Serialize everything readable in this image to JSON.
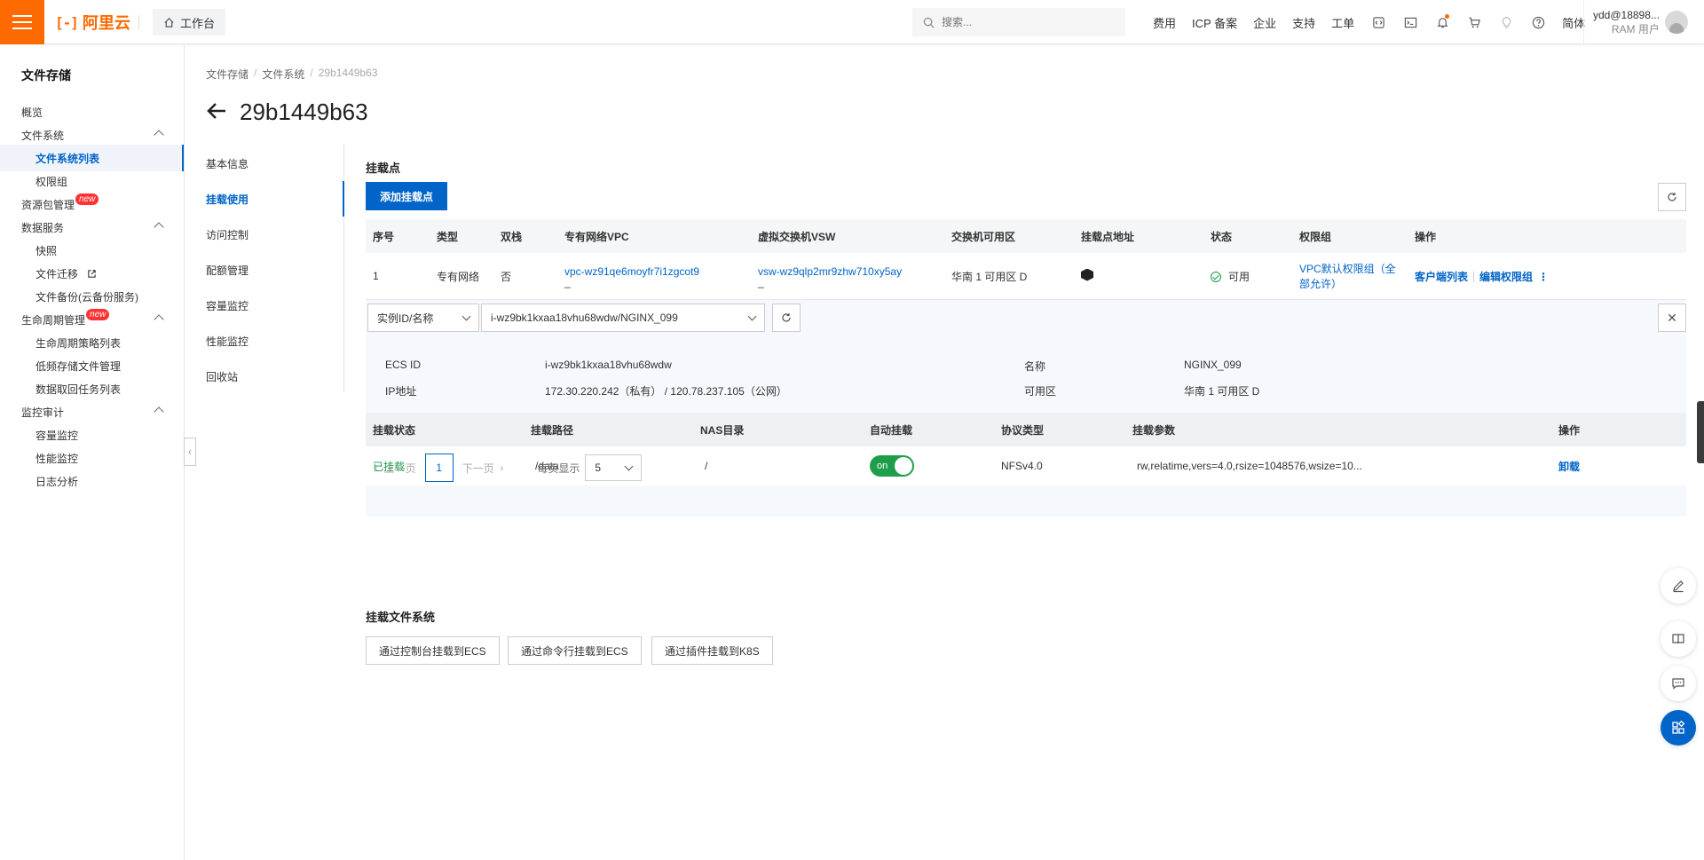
{
  "header": {
    "brand": "阿里云",
    "workbench": "工作台",
    "search_placeholder": "搜索...",
    "nav": [
      "费用",
      "ICP 备案",
      "企业",
      "支持",
      "工单"
    ],
    "lang": "简体",
    "user_name": "ydd@18898...",
    "user_role": "RAM 用户",
    "accent": "#ff6a00"
  },
  "sidebar": {
    "title": "文件存储",
    "items": [
      {
        "label": "概览"
      },
      {
        "label": "文件系统"
      },
      {
        "label": "文件系统列表"
      },
      {
        "label": "权限组"
      },
      {
        "label": "资源包管理"
      },
      {
        "label": "数据服务"
      },
      {
        "label": "快照"
      },
      {
        "label": "文件迁移"
      },
      {
        "label": "文件备份(云备份服务)"
      },
      {
        "label": "生命周期管理"
      },
      {
        "label": "生命周期策略列表"
      },
      {
        "label": "低频存储文件管理"
      },
      {
        "label": "数据取回任务列表"
      },
      {
        "label": "监控审计"
      },
      {
        "label": "容量监控"
      },
      {
        "label": "性能监控"
      },
      {
        "label": "日志分析"
      }
    ],
    "new_badge": "new"
  },
  "breadcrumb": [
    "文件存储",
    "文件系统",
    "29b1449b63"
  ],
  "page_title": "29b1449b63",
  "subnav": [
    "基本信息",
    "挂载使用",
    "访问控制",
    "配额管理",
    "容量监控",
    "性能监控",
    "回收站"
  ],
  "mount": {
    "section_title": "挂载点",
    "add_button": "添加挂载点",
    "columns": [
      "序号",
      "类型",
      "双栈",
      "专有网络VPC",
      "虚拟交换机VSW",
      "交换机可用区",
      "挂载点地址",
      "状态",
      "权限组",
      "操作"
    ],
    "rows": [
      {
        "index": "1",
        "type": "专有网络",
        "dual_stack": "否",
        "vpc": "vpc-wz91qe6moyfr7i1zgcot9",
        "vpc_dash": "_",
        "vsw": "vsw-wz9qlp2mr9zhw710xy5ay",
        "vsw_dash": "_",
        "zone": "华南 1 可用区 D",
        "status": "可用",
        "perm_group_1": "VPC默认权限组（全",
        "perm_group_2": "部允许）",
        "action_1": "客户端列表",
        "action_2": "编辑权限组",
        "more": "⋮"
      }
    ]
  },
  "instance": {
    "filter_type": "实例ID/名称",
    "filter_value": "i-wz9bk1kxaa18vhu68wdw/NGINX_099",
    "ecs_id_label": "ECS ID",
    "ecs_id": "i-wz9bk1kxaa18vhu68wdw",
    "ip_label": "IP地址",
    "ip": "172.30.220.242（私有） / 120.78.237.105（公网）",
    "name_label": "名称",
    "name": "NGINX_099",
    "zone_label": "可用区",
    "zone": "华南 1 可用区 D",
    "columns": [
      "挂载状态",
      "挂载路径",
      "NAS目录",
      "自动挂载",
      "协议类型",
      "挂载参数",
      "操作"
    ],
    "rows": [
      {
        "state": "已挂载",
        "path": "/data",
        "nas_dir": "/",
        "auto_mount": "on",
        "protocol": "NFSv4.0",
        "params": "rw,relatime,vers=4.0,rsize=1048576,wsize=10...",
        "action": "卸载"
      }
    ],
    "pager": {
      "prev": "上一页",
      "current": "1",
      "next": "下一页",
      "per_page_label": "每页显示",
      "per_page": "5"
    }
  },
  "mount_fs": {
    "section_title": "挂载文件系统",
    "buttons": [
      "通过控制台挂载到ECS",
      "通过命令行挂载到ECS",
      "通过插件挂载到K8S"
    ]
  },
  "colors": {
    "primary": "#0064c8",
    "success": "#1e9e4a",
    "danger": "#ff3333"
  }
}
